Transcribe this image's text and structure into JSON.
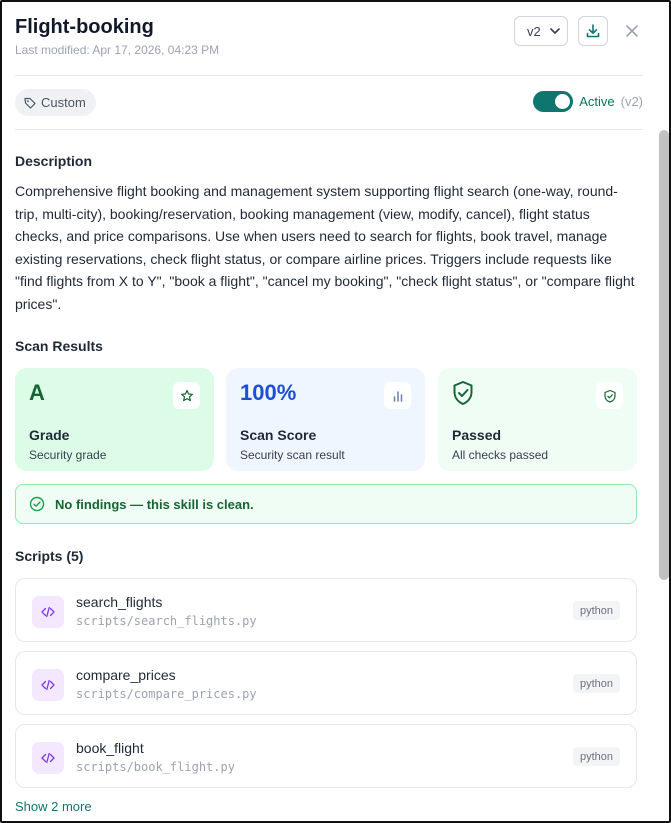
{
  "header": {
    "title": "Flight-booking",
    "modified": "Last modified: Apr 17, 2026, 04:23 PM",
    "version_selected": "v2"
  },
  "tag": {
    "label": "Custom"
  },
  "status": {
    "label": "Active",
    "version": "(v2)"
  },
  "description": {
    "heading": "Description",
    "text": "Comprehensive flight booking and management system supporting flight search (one-way, round-trip, multi-city), booking/reservation, booking management (view, modify, cancel), flight status checks, and price comparisons. Use when users need to search for flights, book travel, manage existing reservations, check flight status, or compare airline prices. Triggers include requests like \"find flights from X to Y\", \"book a flight\", \"cancel my booking\", \"check flight status\", or \"compare flight prices\"."
  },
  "scan": {
    "heading": "Scan Results",
    "grade": {
      "value": "A",
      "title": "Grade",
      "subtitle": "Security grade"
    },
    "score": {
      "value": "100%",
      "title": "Scan Score",
      "subtitle": "Security scan result"
    },
    "passed": {
      "title": "Passed",
      "subtitle": "All checks passed"
    },
    "clean_message": "No findings — this skill is clean."
  },
  "scripts": {
    "heading": "Scripts (5)",
    "items": [
      {
        "name": "search_flights",
        "path": "scripts/search_flights.py",
        "lang": "python"
      },
      {
        "name": "compare_prices",
        "path": "scripts/compare_prices.py",
        "lang": "python"
      },
      {
        "name": "book_flight",
        "path": "scripts/book_flight.py",
        "lang": "python"
      }
    ],
    "more_label": "Show 2 more"
  },
  "colors": {
    "accent": "#0f766e",
    "grade_bg": "#dcfce7",
    "score_bg": "#eff6ff",
    "passed_bg": "#f0fdf4",
    "script_icon_bg": "#f3e8ff"
  }
}
